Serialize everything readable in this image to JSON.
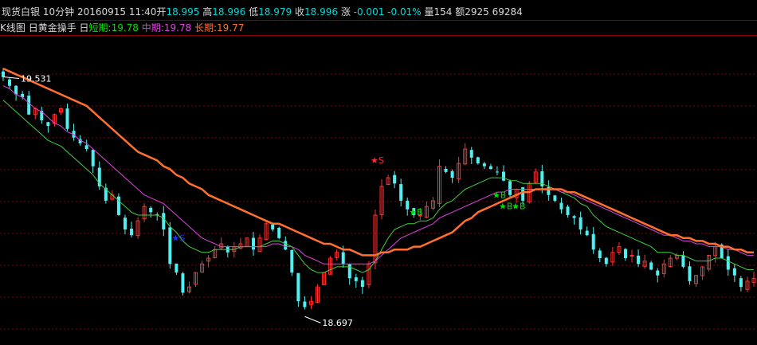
{
  "header": {
    "name": "现货白银",
    "period": "10分钟",
    "datetime": "20160915 11:40",
    "open_label": "开",
    "open": "18.995",
    "high_label": "高",
    "high": "18.996",
    "low_label": "低",
    "low": "18.979",
    "close_label": "收",
    "close": "18.996",
    "change_label": "涨",
    "change": "-0.001",
    "change_pct": "-0.01%",
    "volume_label": "量",
    "volume": "154",
    "amount_label": "额",
    "amount": "2925",
    "extra": "69284"
  },
  "indicator": {
    "chart_label": "K线图",
    "name": "日黄金操手 日",
    "short_label": "短期:",
    "short_value": "19.78",
    "mid_label": "中期:",
    "mid_value": "19.78",
    "long_label": "长期:",
    "long_value": "19.77"
  },
  "colors": {
    "background": "#000000",
    "candle_up": "#ff3030",
    "candle_down": "#50f0f0",
    "short_ma": "#40d040",
    "mid_ma": "#e040e0",
    "long_ma": "#ff7030",
    "grid": "#8a0000",
    "signal_buy": "#00e000",
    "signal_sell_red": "#ff3030",
    "signal_sell_blue": "#2030ff"
  },
  "chart_data": {
    "type": "candlestick",
    "grid": true,
    "y_range": [
      18.62,
      19.66
    ],
    "annotations": [
      {
        "text": "19.531",
        "value": 19.531,
        "role": "period_high"
      },
      {
        "text": "18.697",
        "value": 18.697,
        "role": "period_low"
      }
    ],
    "close_series": [
      19.53,
      19.5,
      19.47,
      19.46,
      19.4,
      19.42,
      19.38,
      19.36,
      19.4,
      19.42,
      19.35,
      19.32,
      19.3,
      19.28,
      19.22,
      19.15,
      19.1,
      19.12,
      19.05,
      19.0,
      18.98,
      19.03,
      19.08,
      19.06,
      19.05,
      19.0,
      18.88,
      18.85,
      18.78,
      18.8,
      18.85,
      18.88,
      18.9,
      18.93,
      18.95,
      18.92,
      18.94,
      18.95,
      18.97,
      18.93,
      18.97,
      19.02,
      19.0,
      18.97,
      18.93,
      18.85,
      18.75,
      18.73,
      18.75,
      18.8,
      18.85,
      18.9,
      18.92,
      18.88,
      18.83,
      18.82,
      18.8,
      18.88,
      19.05,
      19.15,
      19.18,
      19.16,
      19.1,
      19.07,
      19.05,
      19.05,
      19.08,
      19.1,
      19.22,
      19.2,
      19.18,
      19.23,
      19.28,
      19.25,
      19.23,
      19.22,
      19.21,
      19.2,
      19.17,
      19.12,
      19.14,
      19.1,
      19.16,
      19.2,
      19.15,
      19.12,
      19.1,
      19.07,
      19.05,
      19.04,
      19.0,
      18.98,
      18.93,
      18.9,
      18.88,
      18.92,
      18.94,
      18.9,
      18.91,
      18.88,
      18.89,
      18.86,
      18.84,
      18.88,
      18.9,
      18.91,
      18.87,
      18.82,
      18.84,
      18.87,
      18.91,
      18.94,
      18.9,
      18.86,
      18.84,
      18.8,
      18.82,
      18.83
    ],
    "series": [
      {
        "name": "短期",
        "values": [
          19.45,
          19.43,
          19.41,
          19.39,
          19.37,
          19.35,
          19.33,
          19.31,
          19.3,
          19.29,
          19.27,
          19.25,
          19.23,
          19.21,
          19.19,
          19.16,
          19.14,
          19.12,
          19.1,
          19.08,
          19.06,
          19.05,
          19.05,
          19.05,
          19.05,
          19.04,
          19.01,
          18.99,
          18.96,
          18.94,
          18.93,
          18.92,
          18.92,
          18.93,
          18.93,
          18.93,
          18.93,
          18.94,
          18.94,
          18.94,
          18.94,
          18.95,
          18.96,
          18.96,
          18.95,
          18.94,
          18.91,
          18.88,
          18.86,
          18.85,
          18.85,
          18.86,
          18.87,
          18.87,
          18.87,
          18.86,
          18.85,
          18.86,
          18.89,
          18.93,
          18.97,
          19.0,
          19.01,
          19.02,
          19.02,
          19.03,
          19.03,
          19.04,
          19.07,
          19.09,
          19.1,
          19.12,
          19.14,
          19.15,
          19.16,
          19.17,
          19.18,
          19.18,
          19.18,
          19.17,
          19.17,
          19.16,
          19.16,
          19.16,
          19.16,
          19.15,
          19.14,
          19.13,
          19.12,
          19.11,
          19.09,
          19.08,
          19.05,
          19.03,
          19.01,
          19.0,
          18.99,
          18.98,
          18.97,
          18.96,
          18.95,
          18.94,
          18.92,
          18.92,
          18.92,
          18.91,
          18.91,
          18.9,
          18.89,
          18.89,
          18.89,
          18.9,
          18.9,
          18.89,
          18.88,
          18.87,
          18.86,
          18.86
        ]
      },
      {
        "name": "中期",
        "values": [
          19.5,
          19.49,
          19.47,
          19.46,
          19.44,
          19.42,
          19.41,
          19.39,
          19.37,
          19.36,
          19.34,
          19.33,
          19.31,
          19.3,
          19.28,
          19.26,
          19.24,
          19.22,
          19.2,
          19.18,
          19.16,
          19.14,
          19.12,
          19.11,
          19.1,
          19.09,
          19.07,
          19.05,
          19.03,
          19.01,
          18.99,
          18.97,
          18.96,
          18.95,
          18.94,
          18.94,
          18.94,
          18.94,
          18.94,
          18.94,
          18.94,
          18.94,
          18.95,
          18.95,
          18.94,
          18.94,
          18.93,
          18.91,
          18.9,
          18.89,
          18.88,
          18.88,
          18.88,
          18.88,
          18.88,
          18.88,
          18.88,
          18.88,
          18.89,
          18.91,
          18.93,
          18.95,
          18.97,
          18.98,
          18.99,
          19.0,
          19.01,
          19.02,
          19.04,
          19.05,
          19.06,
          19.07,
          19.08,
          19.09,
          19.1,
          19.11,
          19.12,
          19.13,
          19.13,
          19.14,
          19.14,
          19.14,
          19.14,
          19.14,
          19.14,
          19.14,
          19.14,
          19.13,
          19.13,
          19.12,
          19.11,
          19.1,
          19.09,
          19.08,
          19.07,
          19.06,
          19.05,
          19.04,
          19.03,
          19.02,
          19.01,
          19.0,
          18.99,
          18.98,
          18.98,
          18.97,
          18.96,
          18.96,
          18.95,
          18.95,
          18.94,
          18.94,
          18.94,
          18.93,
          18.93,
          18.92,
          18.91,
          18.91
        ]
      },
      {
        "name": "长期",
        "values": [
          19.56,
          19.55,
          19.54,
          19.53,
          19.52,
          19.51,
          19.5,
          19.49,
          19.48,
          19.47,
          19.46,
          19.45,
          19.44,
          19.43,
          19.41,
          19.39,
          19.37,
          19.35,
          19.33,
          19.31,
          19.29,
          19.27,
          19.26,
          19.25,
          19.24,
          19.22,
          19.21,
          19.19,
          19.18,
          19.16,
          19.15,
          19.14,
          19.12,
          19.11,
          19.1,
          19.09,
          19.08,
          19.07,
          19.06,
          19.05,
          19.04,
          19.03,
          19.02,
          19.02,
          19.01,
          19.0,
          18.99,
          18.98,
          18.97,
          18.96,
          18.95,
          18.95,
          18.94,
          18.93,
          18.93,
          18.92,
          18.91,
          18.91,
          18.91,
          18.92,
          18.92,
          18.93,
          18.93,
          18.93,
          18.94,
          18.94,
          18.95,
          18.96,
          18.97,
          18.98,
          18.99,
          19.01,
          19.03,
          19.04,
          19.06,
          19.07,
          19.08,
          19.09,
          19.1,
          19.11,
          19.12,
          19.13,
          19.13,
          19.14,
          19.14,
          19.14,
          19.14,
          19.14,
          19.13,
          19.13,
          19.12,
          19.11,
          19.1,
          19.09,
          19.08,
          19.07,
          19.06,
          19.05,
          19.04,
          19.03,
          19.02,
          19.01,
          19.0,
          18.99,
          18.98,
          18.98,
          18.97,
          18.97,
          18.96,
          18.96,
          18.95,
          18.95,
          18.94,
          18.94,
          18.93,
          18.93,
          18.92,
          18.92
        ]
      }
    ],
    "signals": [
      {
        "index": 27,
        "value": 18.96,
        "label": "S",
        "color": "signal_sell_blue"
      },
      {
        "index": 58,
        "value": 19.23,
        "label": "S",
        "color": "signal_sell_red"
      },
      {
        "index": 64,
        "value": 19.05,
        "label": "B",
        "color": "signal_buy"
      },
      {
        "index": 77,
        "value": 19.11,
        "label": "B",
        "color": "signal_buy"
      },
      {
        "index": 78,
        "value": 19.07,
        "label": "B",
        "color": "signal_buy"
      },
      {
        "index": 80,
        "value": 19.07,
        "label": "B",
        "color": "signal_buy"
      }
    ]
  }
}
